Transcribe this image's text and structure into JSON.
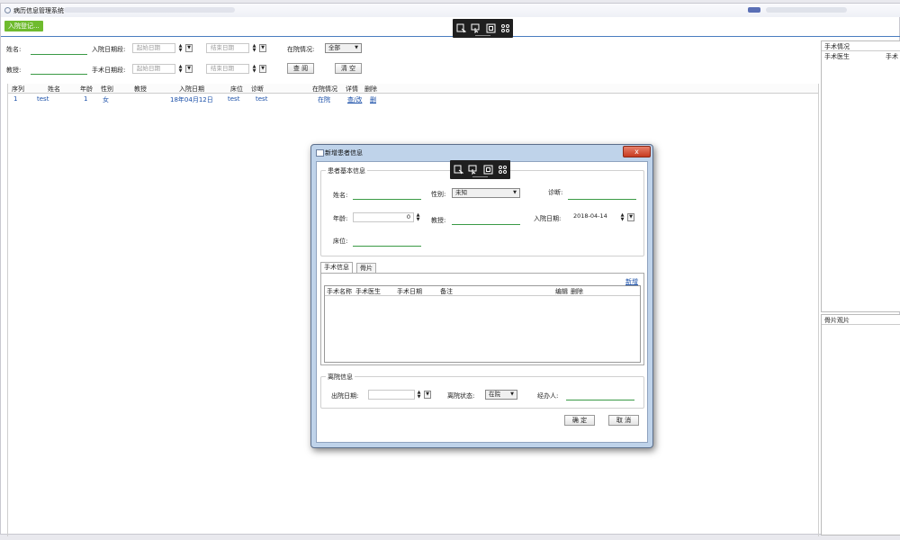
{
  "window": {
    "title": "病历信息管理系统"
  },
  "toolbar": {
    "register_button": "入院登记..."
  },
  "search": {
    "name_label": "姓名:",
    "admit_date_label": "入院日期段:",
    "admit_start_placeholder": "起始日期",
    "admit_end_placeholder": "结束日期",
    "status_label": "在院情况:",
    "status_value": "全部",
    "professor_label": "教授:",
    "surgery_date_label": "手术日期段:",
    "surgery_start_placeholder": "起始日期",
    "surgery_end_placeholder": "结束日期",
    "query_button": "查 阅",
    "clear_button": "清 空"
  },
  "table": {
    "columns": [
      "序列",
      "姓名",
      "年龄",
      "性别",
      "教授",
      "入院日期",
      "床位",
      "诊断",
      "在院情况",
      "详情",
      "删除"
    ],
    "rows": [
      {
        "seq": "1",
        "name": "test",
        "age": "1",
        "gender": "女",
        "professor": "",
        "admit_date": "18年04月12日",
        "bed": "test",
        "diagnosis": "test",
        "status": "在院",
        "detail": "查/改",
        "delete": "删"
      }
    ]
  },
  "right_panel": {
    "surgery_title": "手术情况",
    "surgery_col1": "手术医生",
    "surgery_col2": "手术",
    "xray_title": "骨片观片"
  },
  "dialog": {
    "title": "新增患者信息",
    "close_icon": "x",
    "basic_group": "患者基本信息",
    "name_label": "姓名:",
    "gender_label": "性别:",
    "gender_value": "未知",
    "diagnosis_label": "诊断:",
    "age_label": "年龄:",
    "age_value": "0",
    "professor_label": "教授:",
    "admit_date_label": "入院日期:",
    "admit_date_value": "2018-04-14",
    "bed_label": "床位:",
    "tab_surgery": "手术信息",
    "tab_xray": "骨片",
    "add_link": "新增",
    "surgery_columns": [
      "手术名称",
      "手术医生",
      "手术日期",
      "备注",
      "编辑",
      "删除"
    ],
    "discharge_group": "离院信息",
    "discharge_date_label": "出院日期:",
    "discharge_status_label": "离院状态:",
    "discharge_status_value": "在院",
    "handler_label": "经办人:",
    "ok_button": "确 定",
    "cancel_button": "取 消"
  },
  "colors": {
    "accent_green": "#6fbb2e",
    "link_blue": "#1a4fa8",
    "underline_green": "#3a9a45"
  },
  "icons": [
    "app-icon",
    "screenshot-icon",
    "pointer-icon",
    "frame-icon",
    "settings-icon"
  ]
}
